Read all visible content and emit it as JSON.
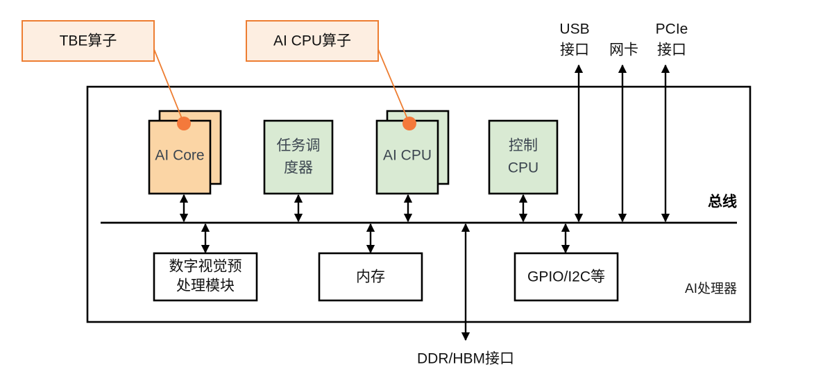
{
  "diagram": {
    "title_label": "AI处理器",
    "bus_label": "总线",
    "callouts": [
      {
        "id": "tbe",
        "label": "TBE算子"
      },
      {
        "id": "aicpu",
        "label": "AI CPU算子"
      }
    ],
    "units": [
      {
        "id": "ai-core",
        "label_line1": "AI Core",
        "label_line2": "",
        "stacked": true,
        "color": "#fbd5a5"
      },
      {
        "id": "task-scheduler",
        "label_line1": "任务调",
        "label_line2": "度器",
        "stacked": false,
        "color": "#d9ead3"
      },
      {
        "id": "ai-cpu",
        "label_line1": "AI CPU",
        "label_line2": "",
        "stacked": true,
        "color": "#d9ead3"
      },
      {
        "id": "control-cpu",
        "label_line1": "控制",
        "label_line2": "CPU",
        "stacked": false,
        "color": "#d9ead3"
      }
    ],
    "peripherals": [
      {
        "id": "dvpp",
        "label_line1": "数字视觉预",
        "label_line2": "处理模块"
      },
      {
        "id": "memory",
        "label_line1": "内存",
        "label_line2": ""
      },
      {
        "id": "gpio",
        "label_line1": "GPIO/I2C等",
        "label_line2": ""
      }
    ],
    "ports": [
      {
        "id": "usb",
        "label_line1": "USB",
        "label_line2": "接口"
      },
      {
        "id": "nic",
        "label_line1": "",
        "label_line2": "网卡"
      },
      {
        "id": "pcie",
        "label_line1": "PCIe",
        "label_line2": "接口"
      }
    ],
    "external_interface": {
      "id": "ddr-hbm",
      "label": "DDR/HBM接口"
    },
    "colors": {
      "ai_core_fill": "#fbd5a5",
      "cpu_fill": "#d9ead3",
      "callout_fill": "#fdeee1",
      "callout_stroke": "#ed7d31",
      "dot": "#f4793b",
      "line": "#000000"
    }
  }
}
